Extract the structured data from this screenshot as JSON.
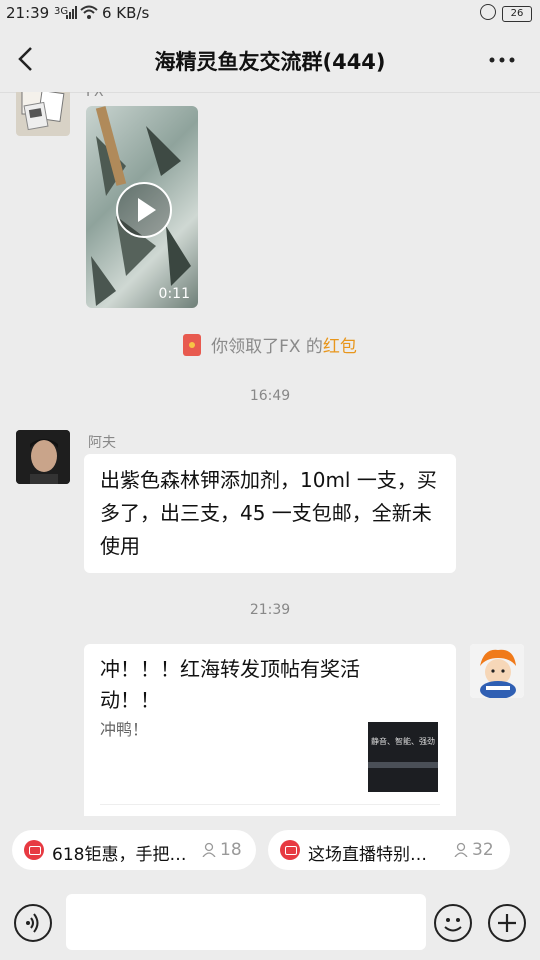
{
  "status_bar": {
    "time": "21:39",
    "network": "3G",
    "speed": "6 KB/s",
    "battery": "26"
  },
  "header": {
    "title": "海精灵鱼友交流群(444)"
  },
  "messages": {
    "m1_sender": "FX",
    "video_duration": "0:11",
    "redpacket_text": "你领取了FX 的",
    "redpacket_link": "红包",
    "time1": "16:49",
    "m2_sender": "阿夫",
    "m2_text": "出紫色森林钾添加剂，10ml 一支，买多了，出三支，45 一支包邮，全新未使用",
    "time2": "21:39",
    "card_title": "冲！！！红海转发顶帖有奖活动！！",
    "card_desc": "冲鸭！",
    "card_thumb_text": "静音、智能、强劲"
  },
  "promo": {
    "item1_text": "618钜惠，手把…",
    "item1_count": "18",
    "item2_text": "这场直播特别…",
    "item2_count": "32"
  },
  "colors": {
    "background": "#ececec",
    "bubble": "#ffffff",
    "redpacket_link": "#e8961c",
    "live_icon": "#e73a42"
  }
}
